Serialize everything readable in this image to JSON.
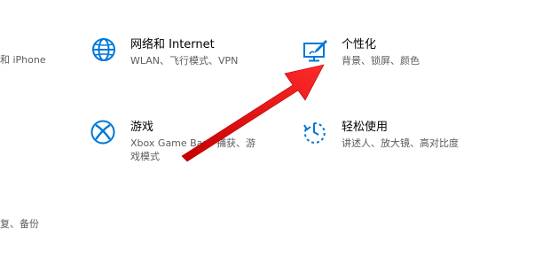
{
  "left_partial": {
    "phone_fragment": "和 iPhone",
    "backup_fragment": "复、备份"
  },
  "tiles": {
    "network": {
      "title": "网络和 Internet",
      "desc": "WLAN、飞行模式、VPN",
      "icon": "globe-icon"
    },
    "personalization": {
      "title": "个性化",
      "desc": "背景、锁屏、颜色",
      "icon": "paint-brush-icon"
    },
    "gaming": {
      "title": "游戏",
      "desc": "Xbox Game Bar、捕获、游戏模式",
      "icon": "xbox-icon"
    },
    "ease_of_access": {
      "title": "轻松使用",
      "desc": "讲述人、放大镜、高对比度",
      "icon": "ease-of-access-icon"
    }
  },
  "colors": {
    "accent": "#0078d7",
    "arrow": "#ee1c1c"
  }
}
